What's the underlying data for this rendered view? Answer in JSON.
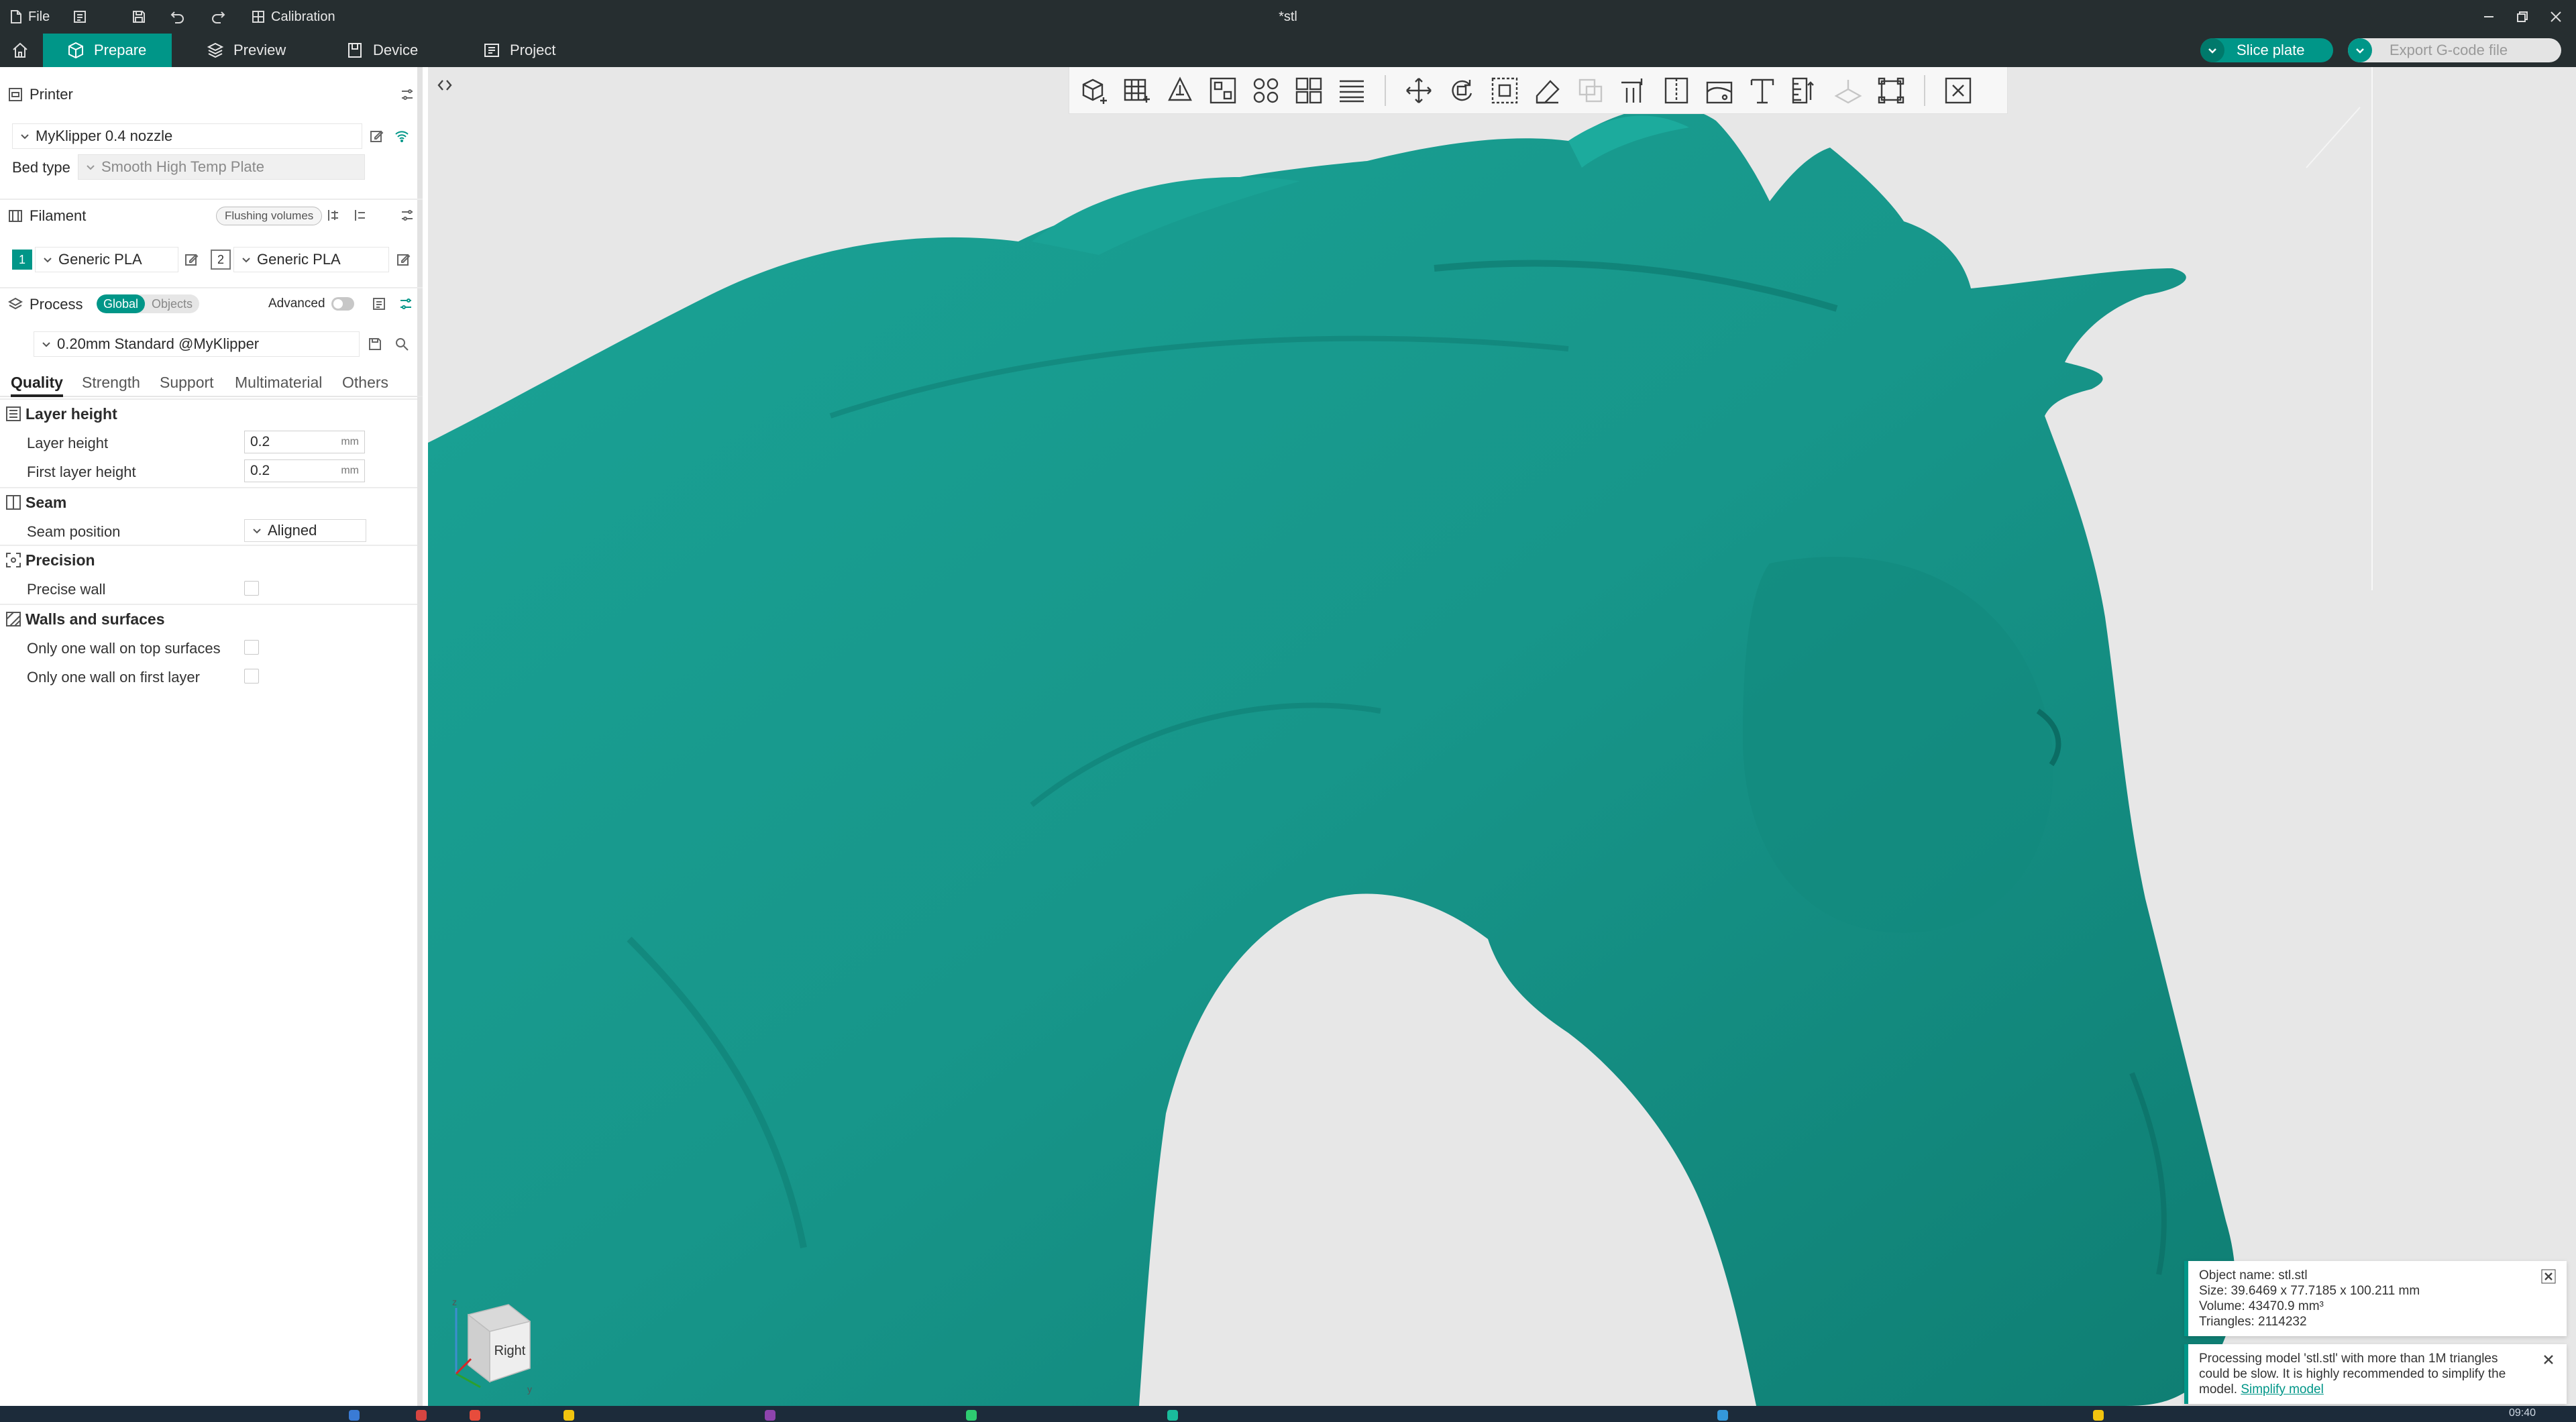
{
  "titlebar": {
    "file_label": "File",
    "calibration_label": "Calibration",
    "document_title": "*stl"
  },
  "nav": {
    "tabs": [
      {
        "label": "Prepare",
        "icon": "cube-icon",
        "active": true
      },
      {
        "label": "Preview",
        "icon": "layers-icon",
        "active": false
      },
      {
        "label": "Device",
        "icon": "device-icon",
        "active": false
      },
      {
        "label": "Project",
        "icon": "project-icon",
        "active": false
      }
    ],
    "slice_plate_label": "Slice plate",
    "export_gcode_label": "Export G-code file"
  },
  "sidebar": {
    "printer": {
      "title": "Printer",
      "selected": "MyKlipper 0.4 nozzle",
      "bed_type_label": "Bed type",
      "bed_type_value": "Smooth High Temp Plate"
    },
    "filament": {
      "title": "Filament",
      "flushing_label": "Flushing volumes",
      "slots": [
        {
          "index": "1",
          "name": "Generic PLA"
        },
        {
          "index": "2",
          "name": "Generic PLA"
        }
      ]
    },
    "process": {
      "title": "Process",
      "mode_global": "Global",
      "mode_objects": "Objects",
      "advanced_label": "Advanced",
      "preset": "0.20mm Standard @MyKlipper",
      "tabs": [
        "Quality",
        "Strength",
        "Support",
        "Multimaterial",
        "Others"
      ],
      "groups": {
        "layer_height": {
          "title": "Layer height",
          "layer_height_label": "Layer height",
          "layer_height_value": "0.2",
          "first_layer_label": "First layer height",
          "first_layer_value": "0.2",
          "unit": "mm"
        },
        "seam": {
          "title": "Seam",
          "position_label": "Seam position",
          "position_value": "Aligned"
        },
        "precision": {
          "title": "Precision",
          "precise_wall_label": "Precise wall"
        },
        "walls": {
          "title": "Walls and surfaces",
          "one_wall_top_label": "Only one wall on top surfaces",
          "one_wall_first_label": "Only one wall on first layer"
        }
      }
    }
  },
  "viewport": {
    "cube_face_label": "Right",
    "axis_z": "z",
    "axis_y": "y",
    "model_color": "#17968a"
  },
  "notifications": {
    "object_info": {
      "name": "Object name: stl.stl",
      "size": "Size: 39.6469 x 77.7185 x 100.211 mm",
      "volume": "Volume: 43470.9 mm³",
      "triangles": "Triangles: 2114232"
    },
    "warning": {
      "text": "Processing model 'stl.stl' with more than 1M triangles could be slow. It is highly recommended to simplify the model.",
      "link": "Simplify model"
    }
  },
  "taskbar": {
    "time": "09:40"
  },
  "colors": {
    "accent": "#009688",
    "titlebar_bg": "#262e30",
    "viewport_bg": "#e7e7e7"
  }
}
